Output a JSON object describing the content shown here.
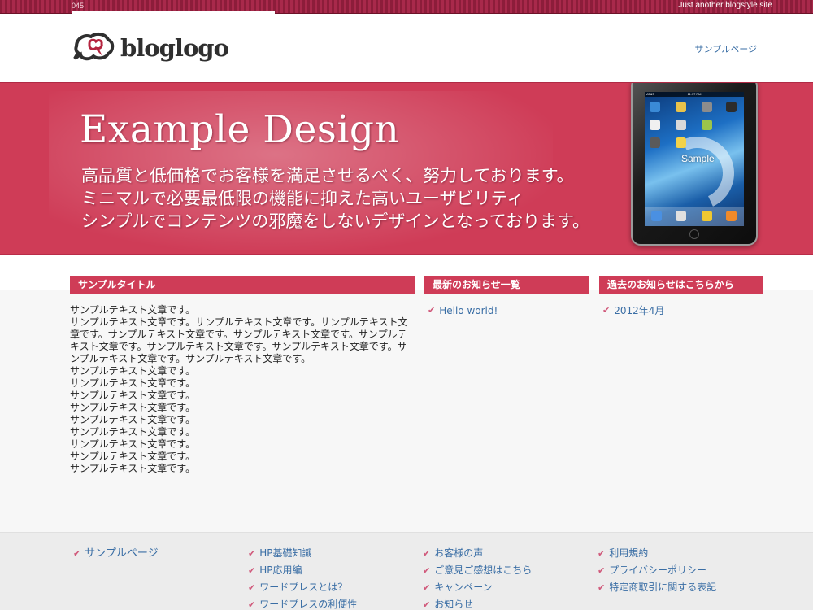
{
  "topbar": {
    "site_id": "045",
    "tagline": "Just another blogstyle site"
  },
  "header": {
    "logo_text_a": "blog",
    "logo_text_b": "logo",
    "nav_items": [
      "サンプルページ"
    ]
  },
  "hero": {
    "title": "Example Design",
    "lines": [
      "高品質と低価格でお客様を満足させるべく、努力しております。",
      "ミニマルで必要最低限の機能に抑えた高いユーザビリティ",
      "シンプルでコンテンツの邪魔をしないデザインとなっております。"
    ],
    "tablet_label": "Sample",
    "tablet_carrier": "AT&T",
    "tablet_time": "11:17 PM"
  },
  "main_section": {
    "heading": "サンプルタイトル",
    "paragraphs": [
      "サンプルテキスト文章です。",
      "サンプルテキスト文章です。サンプルテキスト文章です。サンプルテキスト文章です。サンプルテキスト文章です。サンプルテキスト文章です。サンプルテキスト文章です。サンプルテキスト文章です。サンプルテキスト文章です。サンプルテキスト文章です。サンプルテキスト文章です。",
      "サンプルテキスト文章です。",
      "サンプルテキスト文章です。",
      "サンプルテキスト文章です。",
      "サンプルテキスト文章です。",
      "サンプルテキスト文章です。",
      "サンプルテキスト文章です。",
      "サンプルテキスト文章です。",
      "サンプルテキスト文章です。",
      "サンプルテキスト文章です。"
    ]
  },
  "news_section": {
    "heading": "最新のお知らせ一覧",
    "items": [
      "Hello world!"
    ]
  },
  "past_section": {
    "heading": "過去のお知らせはこちらから",
    "items": [
      "2012年4月"
    ]
  },
  "footer": {
    "col1": [
      "サンプルページ"
    ],
    "col2": [
      "HP基礎知識",
      "HP応用編",
      "ワードプレスとは？",
      "ワードプレスの利便性"
    ],
    "col3": [
      "お客様の声",
      "ご意見ご感想はこちら",
      "キャンペーン",
      "お知らせ"
    ],
    "col4": [
      "利用規約",
      "プライバシーポリシー",
      "特定商取引に関する表記"
    ]
  },
  "colors": {
    "accent": "#cf3c57",
    "topbar": "#8c1d3a",
    "link": "#3a6ea5",
    "check": "#d0587a"
  }
}
